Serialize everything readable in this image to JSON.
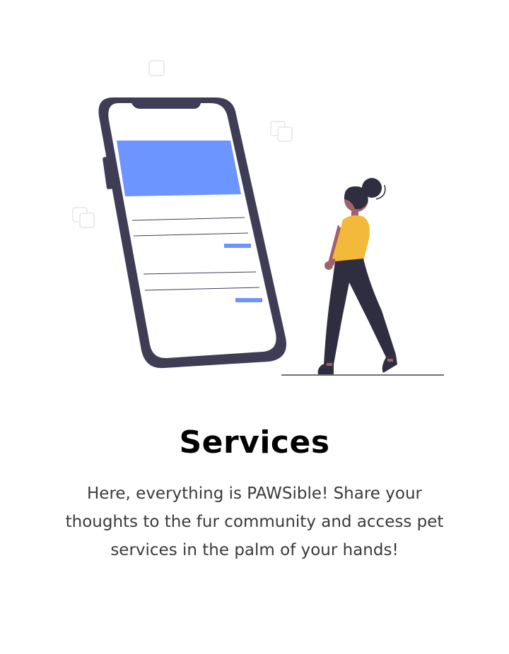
{
  "onboarding": {
    "illustration": {
      "name": "phone-with-woman-illustration",
      "colors": {
        "device_frame": "#3f3d56",
        "accent_blue": "#6c95ff",
        "shirt_yellow": "#f2b93b",
        "hair_dark": "#2f2e41",
        "skin": "#a0616a",
        "outline_light": "#e6e6e6"
      }
    },
    "title": "Services",
    "description": "Here, everything is PAWSible! Share your thoughts to the fur community and access pet services in the palm of your hands!"
  }
}
